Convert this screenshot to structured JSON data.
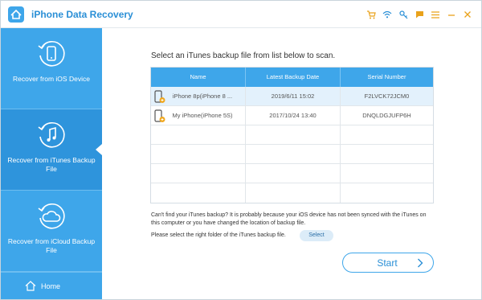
{
  "app": {
    "title": "iPhone Data Recovery"
  },
  "sidebar": {
    "items": [
      {
        "label": "Recover from iOS Device",
        "icon": "phone-recover-icon"
      },
      {
        "label": "Recover from iTunes Backup File",
        "icon": "music-recover-icon"
      },
      {
        "label": "Recover from iCloud Backup File",
        "icon": "cloud-recover-icon"
      }
    ],
    "home_label": "Home"
  },
  "main": {
    "instruction": "Select an iTunes backup file from list below to scan.",
    "table": {
      "columns": [
        "Name",
        "Latest Backup Date",
        "Serial Number"
      ],
      "rows": [
        {
          "name": "iPhone 8p(iPhone 8 ...",
          "date": "2019/6/11 15:02",
          "serial": "F2LVCK72JCM0"
        },
        {
          "name": "My iPhone(iPhone 5S)",
          "date": "2017/10/24 13:40",
          "serial": "DNQLDGJUFP6H"
        }
      ]
    },
    "notice": "Can't find your iTunes backup? It is probably because your iOS device has not been synced with the iTunes on this computer or you have changed the location of backup file.",
    "select_label": "Please select the right folder of the iTunes backup file.",
    "select_button": "Select",
    "start_button": "Start"
  },
  "colors": {
    "accent": "#3ea6ea",
    "accent_dark": "#2e94dc",
    "title_text": "#2a8fd6",
    "tool_icons": "#e9a21b"
  }
}
